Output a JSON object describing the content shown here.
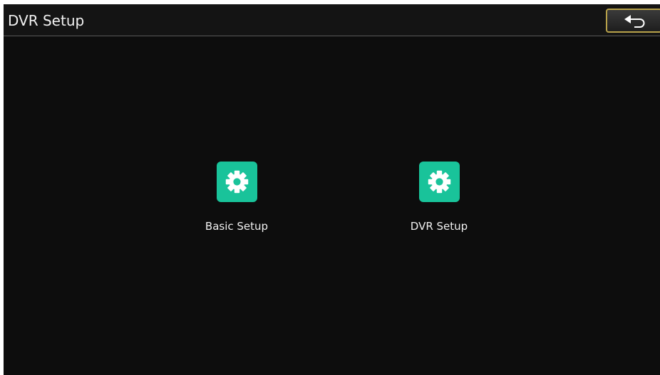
{
  "header": {
    "title": "DVR Setup",
    "back_icon": "back-arrow-icon"
  },
  "menu": {
    "items": [
      {
        "label": "Basic Setup",
        "icon": "gear-icon"
      },
      {
        "label": "DVR Setup",
        "icon": "gear-icon"
      }
    ]
  },
  "colors": {
    "background": "#0d0d0d",
    "icon_tile": "#19c39a",
    "back_button_border": "#b8a24a",
    "text": "#f2f2f2"
  }
}
